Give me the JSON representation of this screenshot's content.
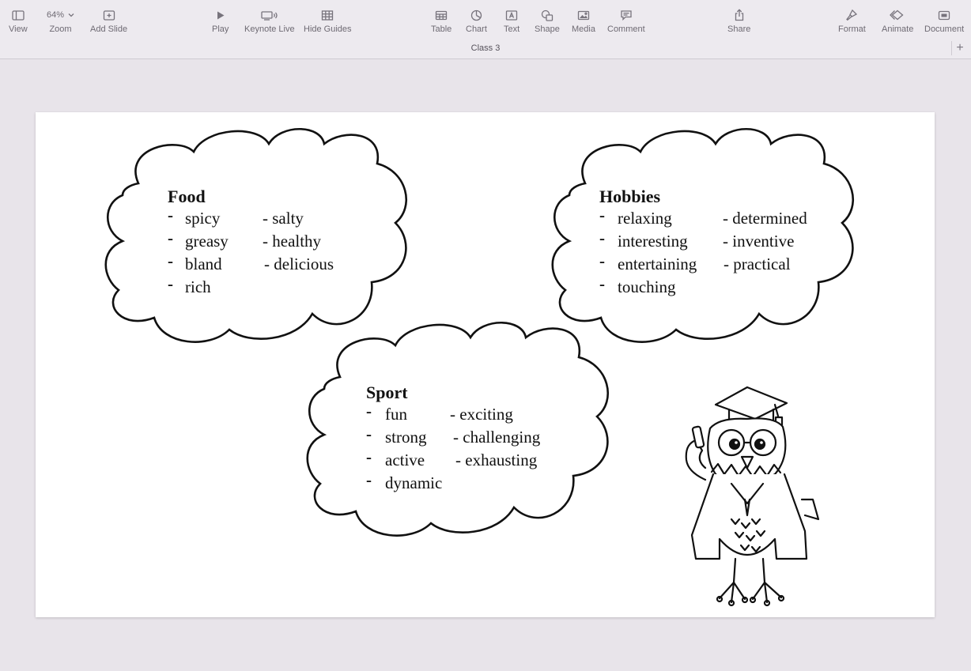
{
  "toolbar": {
    "items": [
      {
        "label": "View",
        "icon": "sidebar-icon"
      },
      {
        "label": "Zoom",
        "value": "64%",
        "icon": "zoom-icon"
      },
      {
        "label": "Add Slide",
        "icon": "add-slide-icon"
      },
      {
        "label": "Play",
        "icon": "play-icon"
      },
      {
        "label": "Keynote Live",
        "icon": "keynote-live-icon"
      },
      {
        "label": "Hide Guides",
        "icon": "grid-icon"
      },
      {
        "label": "Table",
        "icon": "table-icon"
      },
      {
        "label": "Chart",
        "icon": "chart-icon"
      },
      {
        "label": "Text",
        "icon": "text-icon"
      },
      {
        "label": "Shape",
        "icon": "shape-icon"
      },
      {
        "label": "Media",
        "icon": "media-icon"
      },
      {
        "label": "Comment",
        "icon": "comment-icon"
      },
      {
        "label": "Share",
        "icon": "share-icon"
      },
      {
        "label": "Format",
        "icon": "format-icon"
      },
      {
        "label": "Animate",
        "icon": "animate-icon"
      },
      {
        "label": "Document",
        "icon": "document-icon"
      }
    ]
  },
  "document": {
    "title": "Class 3",
    "add_tab": "+"
  },
  "slide": {
    "food": {
      "title": "Food",
      "bullet": "-",
      "col1": [
        "spicy",
        "greasy",
        "bland",
        "rich"
      ],
      "col2": [
        "- salty",
        "- healthy",
        "- delicious"
      ]
    },
    "hobbies": {
      "title": "Hobbies",
      "bullet": "-",
      "col1": [
        "relaxing",
        "interesting",
        "entertaining",
        "touching"
      ],
      "col2": [
        "- determined",
        "- inventive",
        "- practical"
      ]
    },
    "sport": {
      "title": "Sport",
      "bullet": "-",
      "col1": [
        "fun",
        "strong",
        "active",
        "dynamic"
      ],
      "col2": [
        "- exciting",
        "- challenging",
        "- exhausting"
      ]
    }
  },
  "colors": {
    "toolbar_bg": "#edeaef",
    "canvas_bg": "#e8e4ea",
    "slide_bg": "#ffffff",
    "ink": "#111111"
  }
}
